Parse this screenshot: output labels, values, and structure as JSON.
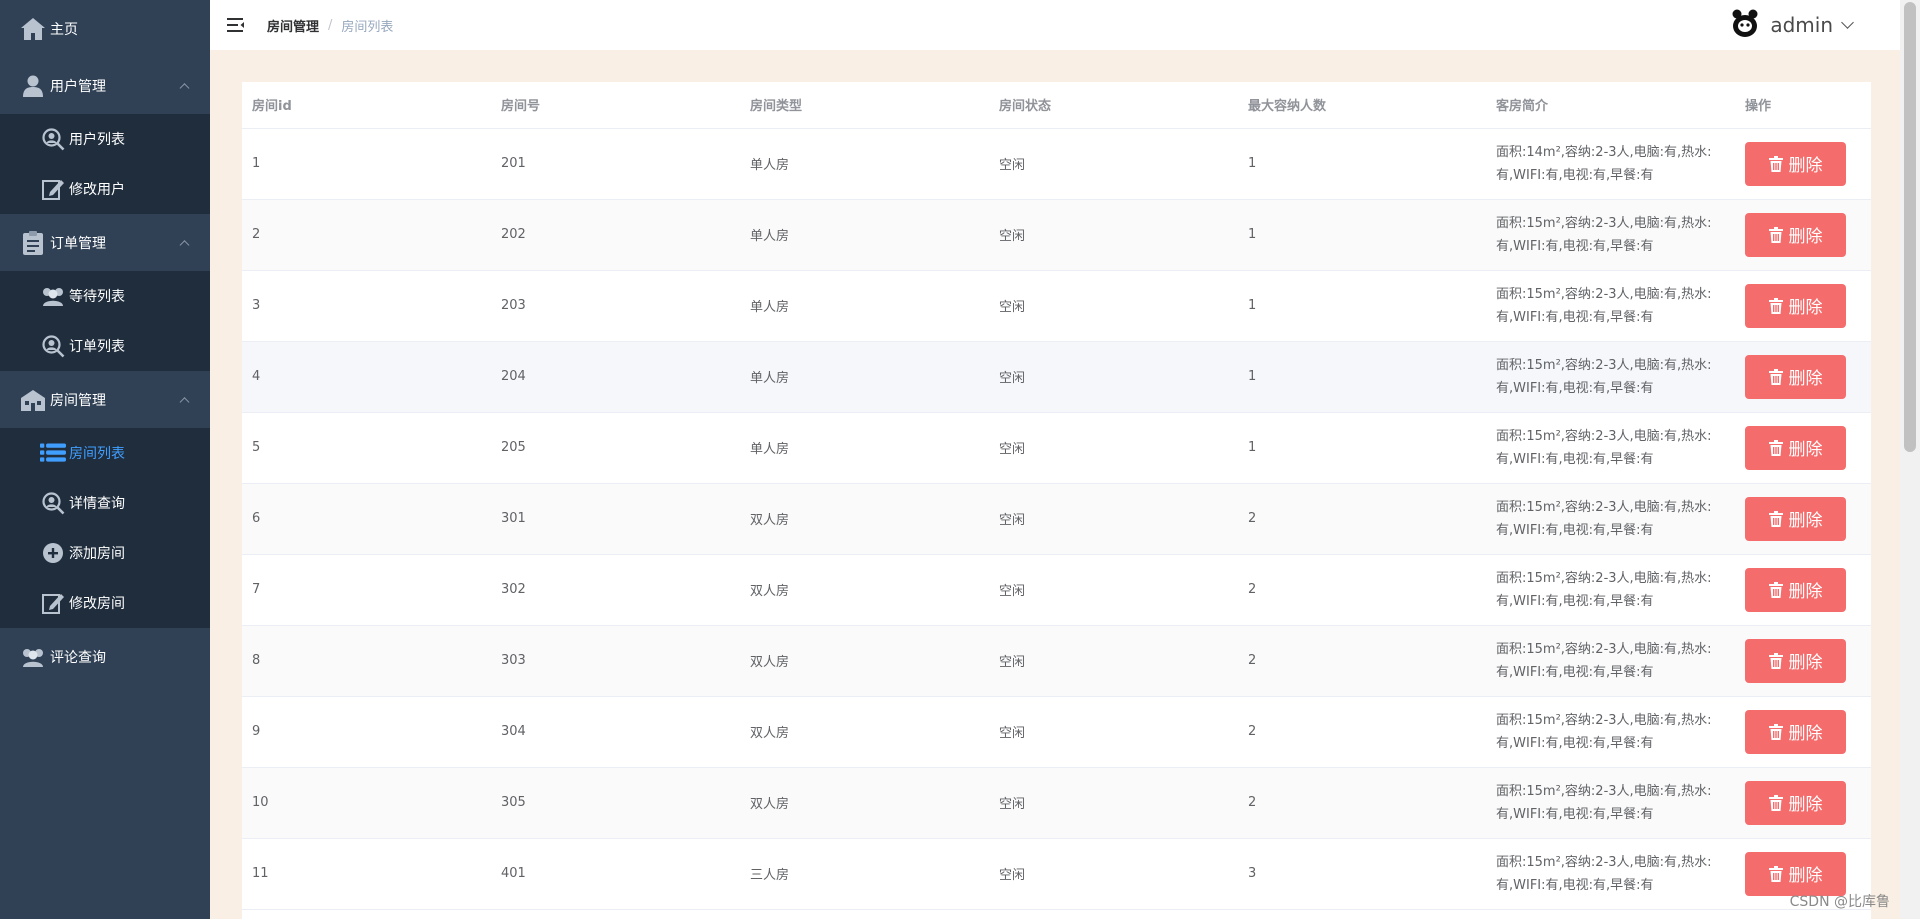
{
  "sidebar": {
    "home": "主页",
    "groups": [
      {
        "title": "用户管理",
        "items": [
          "用户列表",
          "修改用户"
        ]
      },
      {
        "title": "订单管理",
        "items": [
          "等待列表",
          "订单列表"
        ]
      },
      {
        "title": "房间管理",
        "items": [
          "房间列表",
          "详情查询",
          "添加房间",
          "修改房间"
        ]
      }
    ],
    "comments": "评论查询",
    "active_item": "房间列表",
    "active_color": "#409eff"
  },
  "header": {
    "breadcrumb": [
      "房间管理",
      "房间列表"
    ],
    "separator": "/",
    "user": "admin"
  },
  "table": {
    "columns": [
      "房间id",
      "房间号",
      "房间类型",
      "房间状态",
      "最大容纳人数",
      "客房简介",
      "操作"
    ],
    "delete_label": "删除",
    "rows": [
      {
        "id": "1",
        "number": "201",
        "type": "单人房",
        "status": "空闲",
        "capacity": "1",
        "desc": "面积:14m²,容纳:2-3人,电脑:有,热水:有,WIFI:有,电视:有,早餐:有"
      },
      {
        "id": "2",
        "number": "202",
        "type": "单人房",
        "status": "空闲",
        "capacity": "1",
        "desc": "面积:15m²,容纳:2-3人,电脑:有,热水:有,WIFI:有,电视:有,早餐:有"
      },
      {
        "id": "3",
        "number": "203",
        "type": "单人房",
        "status": "空闲",
        "capacity": "1",
        "desc": "面积:15m²,容纳:2-3人,电脑:有,热水:有,WIFI:有,电视:有,早餐:有"
      },
      {
        "id": "4",
        "number": "204",
        "type": "单人房",
        "status": "空闲",
        "capacity": "1",
        "desc": "面积:15m²,容纳:2-3人,电脑:有,热水:有,WIFI:有,电视:有,早餐:有"
      },
      {
        "id": "5",
        "number": "205",
        "type": "单人房",
        "status": "空闲",
        "capacity": "1",
        "desc": "面积:15m²,容纳:2-3人,电脑:有,热水:有,WIFI:有,电视:有,早餐:有"
      },
      {
        "id": "6",
        "number": "301",
        "type": "双人房",
        "status": "空闲",
        "capacity": "2",
        "desc": "面积:15m²,容纳:2-3人,电脑:有,热水:有,WIFI:有,电视:有,早餐:有"
      },
      {
        "id": "7",
        "number": "302",
        "type": "双人房",
        "status": "空闲",
        "capacity": "2",
        "desc": "面积:15m²,容纳:2-3人,电脑:有,热水:有,WIFI:有,电视:有,早餐:有"
      },
      {
        "id": "8",
        "number": "303",
        "type": "双人房",
        "status": "空闲",
        "capacity": "2",
        "desc": "面积:15m²,容纳:2-3人,电脑:有,热水:有,WIFI:有,电视:有,早餐:有"
      },
      {
        "id": "9",
        "number": "304",
        "type": "双人房",
        "status": "空闲",
        "capacity": "2",
        "desc": "面积:15m²,容纳:2-3人,电脑:有,热水:有,WIFI:有,电视:有,早餐:有"
      },
      {
        "id": "10",
        "number": "305",
        "type": "双人房",
        "status": "空闲",
        "capacity": "2",
        "desc": "面积:15m²,容纳:2-3人,电脑:有,热水:有,WIFI:有,电视:有,早餐:有"
      },
      {
        "id": "11",
        "number": "401",
        "type": "三人房",
        "status": "空闲",
        "capacity": "3",
        "desc": "面积:15m²,容纳:2-3人,电脑:有,热水:有,WIFI:有,电视:有,早餐:有"
      }
    ]
  },
  "watermark": "CSDN @比库鲁",
  "colors": {
    "sidebar_bg": "#304156",
    "submenu_bg": "#1f2d3d",
    "danger": "#f56c6c",
    "page_bg": "#f9efe4"
  }
}
